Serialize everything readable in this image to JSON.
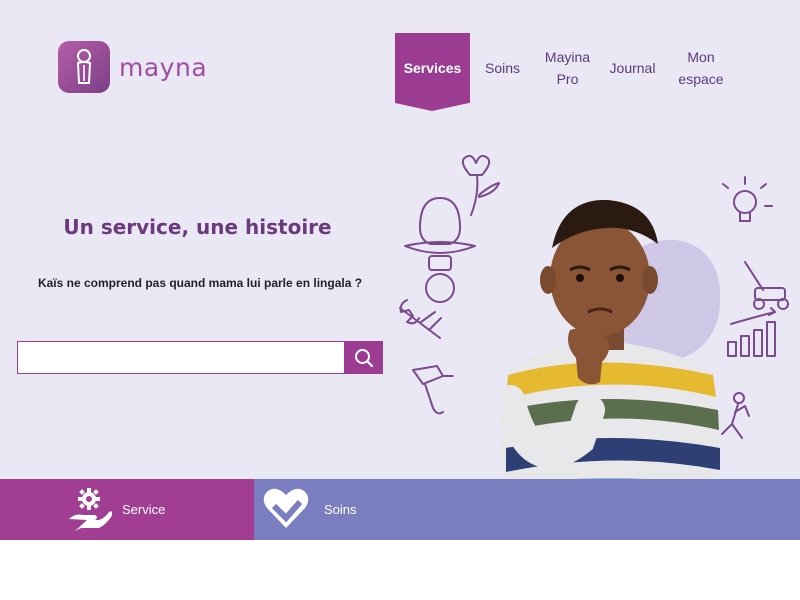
{
  "brand": {
    "name": "mayna"
  },
  "nav": {
    "items": [
      {
        "label": "Services"
      },
      {
        "label": "Soins"
      },
      {
        "label_line1": "Mayina",
        "label_line2": "Pro"
      },
      {
        "label": "Journal"
      },
      {
        "label_line1": "Mon",
        "label_line2": "espace"
      }
    ]
  },
  "hero": {
    "headline": "Un service, une histoire",
    "question": "Kaïs ne comprend pas quand mama lui parle en lingala ?"
  },
  "search": {
    "placeholder": "",
    "value": ""
  },
  "tabs": [
    {
      "label": "Service",
      "icon": "gear-hand-icon"
    },
    {
      "label": "Soins",
      "icon": "heart-check-icon"
    }
  ],
  "colors": {
    "primary": "#9b3c92",
    "secondary": "#7a7dbf",
    "background": "#ebe8f6",
    "text_purple": "#6a3a7c"
  }
}
